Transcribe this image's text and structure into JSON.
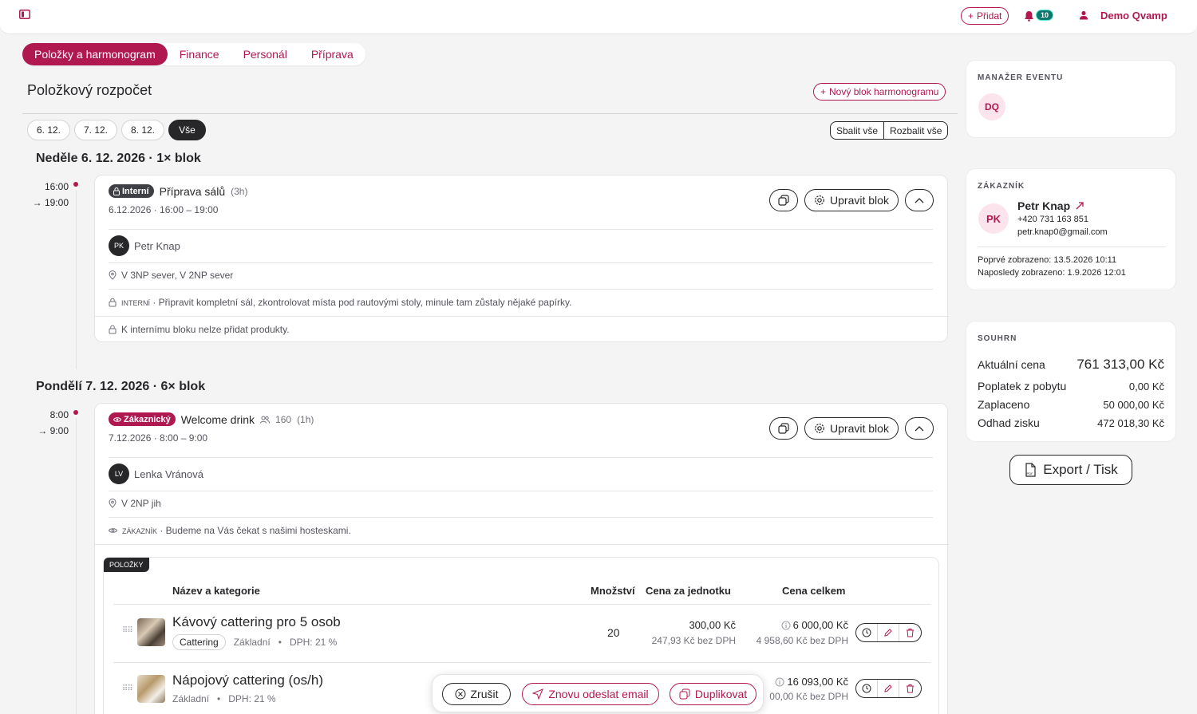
{
  "header": {
    "add_label": "Přidat",
    "notif_count": "10",
    "user_name": "Demo Qvamp"
  },
  "tabs": [
    {
      "label": "Položky a harmonogram",
      "active": true
    },
    {
      "label": "Finance"
    },
    {
      "label": "Personál"
    },
    {
      "label": "Příprava"
    }
  ],
  "main": {
    "title": "Položkový rozpočet",
    "new_block_label": "Nový blok harmonogramu",
    "date_chips": [
      "6. 12.",
      "7. 12.",
      "8. 12.",
      "Vše"
    ],
    "collapse_all": "Sbalit vše",
    "expand_all": "Rozbalit vše"
  },
  "days": [
    {
      "title": "Neděle 6. 12. 2026 · 1× blok",
      "time_start": "16:00",
      "time_end": "→ 19:00",
      "block": {
        "badge": "Interní",
        "name": "Příprava sálů",
        "duration": "(3h)",
        "datetime": "6.12.2026 · 16:00 – 19:00",
        "edit_label": "Upravit blok",
        "person_initials": "PK",
        "person_name": "Petr Knap",
        "location": "V 3NP sever, V 2NP sever",
        "note_prefix": "INTERNÍ",
        "note_text": " · Připravit kompletní sál, zkontrolovat místa pod rautovými stoly, minule tam zůstaly nějaké papírky.",
        "products_note": "K internímu bloku nelze přidat produkty."
      }
    },
    {
      "title": "Pondělí 7. 12. 2026 · 6× blok",
      "time_start": "8:00",
      "time_end": "→ 9:00",
      "block": {
        "badge": "Zákaznický",
        "name": "Welcome drink",
        "guests": "160",
        "duration": "(1h)",
        "datetime": "7.12.2026 · 8:00 – 9:00",
        "edit_label": "Upravit blok",
        "person_initials": "LV",
        "person_name": "Lenka Vránová",
        "location": "V 2NP jih",
        "note_prefix": "ZÁKAZNÍK",
        "note_text": " · Budeme na Vás čekat s našimi hosteskami.",
        "items_label": "POLOŽKY",
        "columns": [
          "Název a kategorie",
          "Množství",
          "Cena za jednotku",
          "Cena celkem"
        ],
        "items": [
          {
            "name": "Kávový cattering pro 5 osob",
            "tag": "Cattering",
            "type": "Základní",
            "vat": "DPH: 21 %",
            "qty": "20",
            "unit_price": "300,00 Kč",
            "unit_price_net": "247,93 Kč bez DPH",
            "total": "6 000,00 Kč",
            "total_net": "4 958,60 Kč bez DPH"
          },
          {
            "name": "Nápojový cattering (os/h)",
            "type": "Základní",
            "vat": "DPH: 21 %",
            "total": "16 093,00 Kč",
            "total_net": "00,00 Kč bez DPH"
          }
        ]
      }
    }
  ],
  "sidebar": {
    "manager_label": "MANAŽER EVENTU",
    "manager_initials": "DQ",
    "customer_label": "ZÁKAZNÍK",
    "customer_initials": "PK",
    "customer_name": "Petr Knap",
    "customer_phone": "+420 731 163 851",
    "customer_email": "petr.knap0@gmail.com",
    "first_seen": "Poprvé zobrazeno: 13.5.2026 10:11",
    "last_seen": "Naposledy zobrazeno: 1.9.2026 12:01",
    "summary_label": "SOUHRN",
    "summary": [
      {
        "label": "Aktuální cena",
        "value": "761 313,00 Kč"
      },
      {
        "label": "Poplatek z pobytu",
        "value": "0,00 Kč"
      },
      {
        "label": "Zaplaceno",
        "value": "50 000,00 Kč"
      },
      {
        "label": "Odhad zisku",
        "value": "472 018,30 Kč"
      }
    ],
    "export_label": "Export / Tisk"
  },
  "bottom_bar": {
    "cancel": "Zrušit",
    "resend": "Znovu odeslat email",
    "duplicate": "Duplikovat"
  },
  "colors": {
    "accent": "#b0194f",
    "dark": "#27272a",
    "background": "#f4f4f5"
  }
}
